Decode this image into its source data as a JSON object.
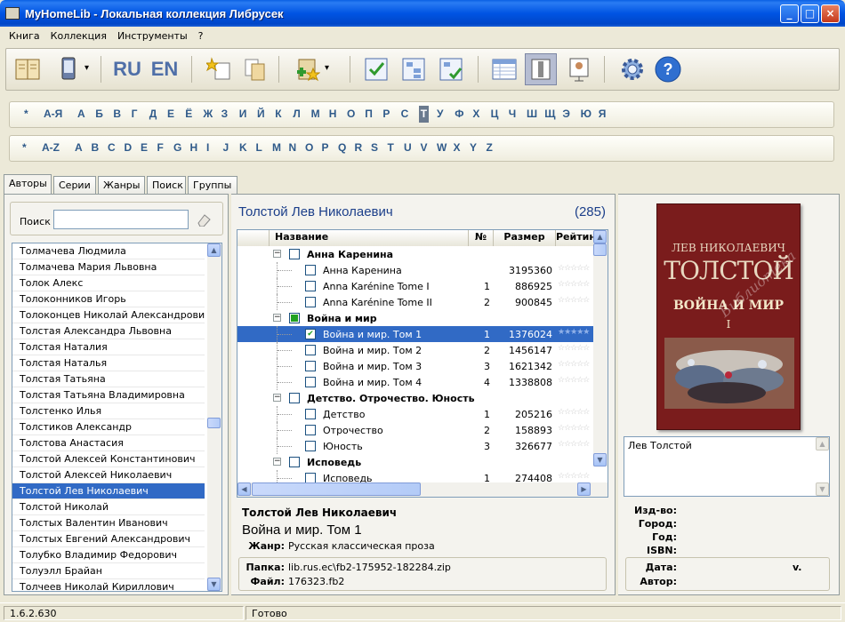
{
  "window": {
    "title": "MyHomeLib - Локальная коллекция Либрусек",
    "minimize": "_",
    "maximize": "□",
    "close": "×"
  },
  "menu": [
    "Книга",
    "Коллекция",
    "Инструменты",
    "?"
  ],
  "toolbar": {
    "lang_ru": "RU",
    "lang_en": "EN",
    "help": "?",
    "dropdown": "▾"
  },
  "alpha_ru": [
    "*",
    "А-Я",
    "А",
    "Б",
    "В",
    "Г",
    "Д",
    "Е",
    "Ё",
    "Ж",
    "З",
    "И",
    "Й",
    "К",
    "Л",
    "М",
    "Н",
    "О",
    "П",
    "Р",
    "С",
    "Т",
    "У",
    "Ф",
    "Х",
    "Ц",
    "Ч",
    "Ш",
    "Щ",
    "Э",
    "Ю",
    "Я"
  ],
  "alpha_ru_selected": "Т",
  "alpha_en": [
    "*",
    "A-Z",
    "A",
    "B",
    "C",
    "D",
    "E",
    "F",
    "G",
    "H",
    "I",
    "J",
    "K",
    "L",
    "M",
    "N",
    "O",
    "P",
    "Q",
    "R",
    "S",
    "T",
    "U",
    "V",
    "W",
    "X",
    "Y",
    "Z"
  ],
  "tabs": [
    "Авторы",
    "Серии",
    "Жанры",
    "Поиск",
    "Группы"
  ],
  "search": {
    "label": "Поиск",
    "value": ""
  },
  "authors": [
    "Толмачева Людмила",
    "Толмачева Мария Львовна",
    "Толок Алекс",
    "Толоконников Игорь",
    "Толоконцев Николай Александрович",
    "Толстая Александра Львовна",
    "Толстая Наталия",
    "Толстая Наталья",
    "Толстая Татьяна",
    "Толстая Татьяна Владимировна",
    "Толстенко Илья",
    "Толстиков Александр",
    "Толстова Анастасия",
    "Толстой Алексей Константинович",
    "Толстой Алексей Николаевич",
    "Толстой Лев Николаевич",
    "Толстой Николай",
    "Толстых Валентин Иванович",
    "Толстых Евгений Александрович",
    "Толубко Владимир Федорович",
    "Толуэлл Брайан",
    "Толчеев Николай Кириллович"
  ],
  "selected_author": "Толстой Лев Николаевич",
  "books_header": {
    "author": "Толстой Лев Николаевич",
    "count": "(285)"
  },
  "columns": {
    "name": "Название",
    "no": "№",
    "size": "Размер",
    "rating": "Рейтинг"
  },
  "book_rows": [
    {
      "type": "group",
      "title": "Анна Каренина",
      "no": "",
      "size": "",
      "expander": "−"
    },
    {
      "type": "book",
      "title": "Анна Каренина",
      "no": "",
      "size": "3195360"
    },
    {
      "type": "book",
      "title": "Anna Karénine Tome I",
      "no": "1",
      "size": "886925"
    },
    {
      "type": "book",
      "title": "Anna Karénine Tome II",
      "no": "2",
      "size": "900845"
    },
    {
      "type": "group",
      "title": "Война и мир",
      "no": "",
      "size": "",
      "expander": "−",
      "partial": true
    },
    {
      "type": "book",
      "title": "Война и мир. Том 1",
      "no": "1",
      "size": "1376024",
      "selected": true,
      "checked": true
    },
    {
      "type": "book",
      "title": "Война и мир. Том 2",
      "no": "2",
      "size": "1456147"
    },
    {
      "type": "book",
      "title": "Война и мир. Том 3",
      "no": "3",
      "size": "1621342"
    },
    {
      "type": "book",
      "title": "Война и мир. Том 4",
      "no": "4",
      "size": "1338808"
    },
    {
      "type": "group",
      "title": "Детство. Отрочество. Юность",
      "no": "",
      "size": "",
      "expander": "−"
    },
    {
      "type": "book",
      "title": "Детство",
      "no": "1",
      "size": "205216"
    },
    {
      "type": "book",
      "title": "Отрочество",
      "no": "2",
      "size": "158893"
    },
    {
      "type": "book",
      "title": "Юность",
      "no": "3",
      "size": "326677"
    },
    {
      "type": "group",
      "title": "Исповедь",
      "no": "",
      "size": "",
      "expander": "−"
    },
    {
      "type": "book",
      "title": "Исповедь",
      "no": "1",
      "size": "274408"
    }
  ],
  "stars": "☆☆☆☆☆",
  "stars_selected": "★★★★★",
  "details": {
    "author": "Толстой Лев Николаевич",
    "title": "Война и мир. Том 1",
    "genre_label": "Жанр:",
    "genre": "Русская классическая проза",
    "folder_label": "Папка:",
    "folder": "lib.rus.ec\\fb2-175952-182284.zip",
    "file_label": "Файл:",
    "file": "176323.fb2"
  },
  "cover": {
    "author": "ЛЕВ НИКОЛАЕВИЧ",
    "surname": "ТОЛСТОЙ",
    "title": "ВОЙНА И МИР",
    "volume": "I",
    "watermark": "Библиотека",
    "bg": "#7a1c1c"
  },
  "annotation": "Лев Толстой",
  "meta": {
    "publisher": "Изд-во:",
    "city": "Город:",
    "year": "Год:",
    "isbn": "ISBN:",
    "date": "Дата:",
    "version": "v.",
    "author": "Автор:"
  },
  "status": {
    "version": "1.6.2.630",
    "state": "Готово"
  },
  "colors": {
    "selection": "#316ac5",
    "letters": "#2f5a8a"
  }
}
